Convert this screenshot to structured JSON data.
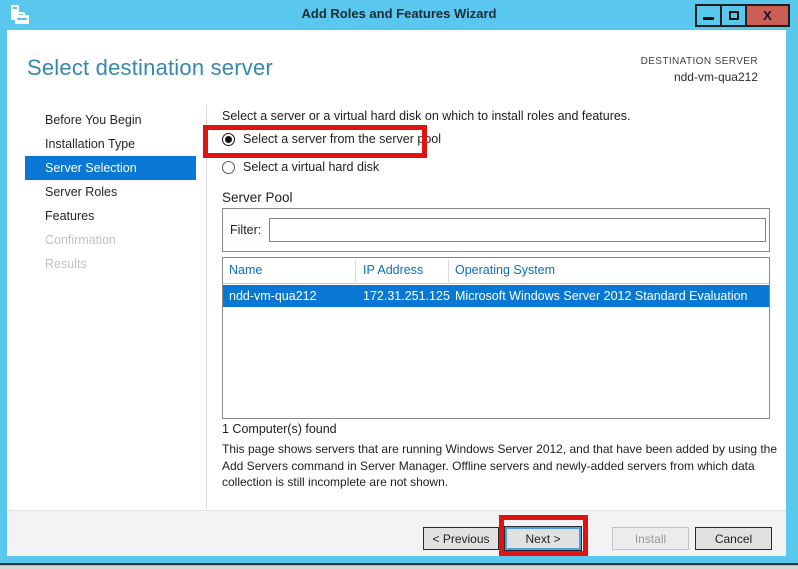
{
  "window": {
    "title": "Add Roles and Features Wizard",
    "controls": {
      "minimize_glyph": "",
      "maximize_glyph": "",
      "close_glyph": "X"
    }
  },
  "header": {
    "title": "Select destination server",
    "destination_label": "DESTINATION SERVER",
    "destination_server": "ndd-vm-qua212"
  },
  "sidebar": {
    "items": [
      {
        "label": "Before You Begin",
        "state": "normal"
      },
      {
        "label": "Installation Type",
        "state": "normal"
      },
      {
        "label": "Server Selection",
        "state": "selected"
      },
      {
        "label": "Server Roles",
        "state": "normal"
      },
      {
        "label": "Features",
        "state": "normal"
      },
      {
        "label": "Confirmation",
        "state": "disabled"
      },
      {
        "label": "Results",
        "state": "disabled"
      }
    ]
  },
  "main": {
    "intro": "Select a server or a virtual hard disk on which to install roles and features.",
    "radios": {
      "server_pool": {
        "label": "Select a server from the server pool",
        "selected": true
      },
      "vhd": {
        "label": "Select a virtual hard disk",
        "selected": false
      }
    },
    "server_pool": {
      "title": "Server Pool",
      "filter_label": "Filter:",
      "filter_value": ""
    },
    "table": {
      "columns": [
        "Name",
        "IP Address",
        "Operating System"
      ],
      "rows": [
        {
          "name": "ndd-vm-qua212",
          "ip": "172.31.251.125",
          "os": "Microsoft Windows Server 2012 Standard Evaluation",
          "selected": true
        }
      ]
    },
    "found": "1 Computer(s) found",
    "description": "This page shows servers that are running Windows Server 2012, and that have been added by using the Add Servers command in Server Manager. Offline servers and newly-added servers from which data collection is still incomplete are not shown."
  },
  "footer": {
    "previous": "< Previous",
    "next": "Next >",
    "install": "Install",
    "cancel": "Cancel"
  },
  "colors": {
    "frame_blue": "#5ac8ee",
    "accent_blue": "#0878d4",
    "heading_blue": "#3787ae",
    "table_header_blue": "#0a6ebd",
    "close_button_red": "#cb5f55",
    "annotation_red": "#e01212"
  }
}
